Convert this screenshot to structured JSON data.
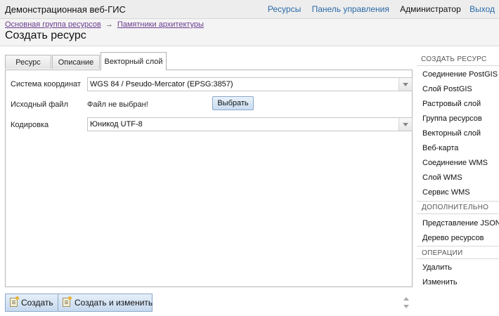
{
  "app": {
    "title": "Демонстрационная веб-ГИС",
    "nav": {
      "resources": "Ресурсы",
      "control_panel": "Панель управления",
      "user": "Администратор",
      "logout": "Выход"
    }
  },
  "breadcrumbs": {
    "items": [
      "Основная группа ресурсов",
      "Памятники архитектуры"
    ],
    "separator": "→"
  },
  "page_title": "Создать ресурс",
  "tabs": [
    {
      "label": "Ресурс",
      "active": false
    },
    {
      "label": "Описание",
      "active": false
    },
    {
      "label": "Векторный слой",
      "active": true
    }
  ],
  "form": {
    "crs": {
      "label": "Система координат",
      "value": "WGS 84 / Pseudo-Mercator (EPSG:3857)"
    },
    "source_file": {
      "label": "Исходный файл",
      "status": "Файл не выбран!",
      "button": "Выбрать"
    },
    "encoding": {
      "label": "Кодировка",
      "value": "Юникод UTF-8"
    }
  },
  "actions": {
    "create": "Создать",
    "create_and_edit": "Создать и изменить"
  },
  "sidebar": {
    "create_heading": "СОЗДАТЬ РЕСУРС",
    "create_items": [
      "Соединение PostGIS",
      "Слой PostGIS",
      "Растровый слой",
      "Группа ресурсов",
      "Векторный слой",
      "Веб-карта",
      "Соединение WMS",
      "Слой WMS",
      "Сервис WMS"
    ],
    "extra_heading": "ДОПОЛНИТЕЛЬНО",
    "extra_items": [
      "Представление JSON",
      "Дерево ресурсов"
    ],
    "ops_heading": "ОПЕРАЦИИ",
    "ops_items": [
      "Удалить",
      "Изменить"
    ]
  },
  "colors": {
    "link": "#2a6aa8",
    "visited_link": "#6a3b8f",
    "button_fill": "#c9dcf1",
    "button_border": "#8ca9c9"
  }
}
